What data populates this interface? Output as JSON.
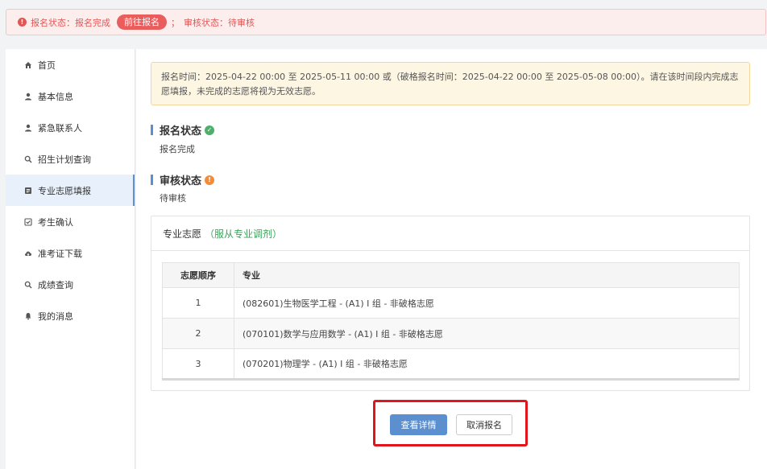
{
  "alert": {
    "status_text": "报名状态：报名完成",
    "go_button": "前往报名",
    "separator": "；",
    "review_text": "审核状态：待审核"
  },
  "sidebar": {
    "items": [
      {
        "label": "首页",
        "icon": "home-icon"
      },
      {
        "label": "基本信息",
        "icon": "user-icon"
      },
      {
        "label": "紧急联系人",
        "icon": "user-icon"
      },
      {
        "label": "招生计划查询",
        "icon": "search-icon"
      },
      {
        "label": "专业志愿填报",
        "icon": "form-icon",
        "active": true
      },
      {
        "label": "考生确认",
        "icon": "checkbox-icon"
      },
      {
        "label": "准考证下载",
        "icon": "cloud-download-icon"
      },
      {
        "label": "成绩查询",
        "icon": "search-icon"
      },
      {
        "label": "我的消息",
        "icon": "bell-icon"
      }
    ]
  },
  "notice": {
    "text": "报名时间：2025-04-22 00:00 至 2025-05-11 00:00 或（破格报名时间：2025-04-22 00:00 至 2025-05-08 00:00）。请在该时间段内完成志愿填报，未完成的志愿将视为无效志愿。"
  },
  "registration": {
    "title": "报名状态",
    "value": "报名完成"
  },
  "review": {
    "title": "审核状态",
    "value": "待审核"
  },
  "preferences": {
    "title": "专业志愿",
    "paren_open": "（",
    "adjust_label": "服从专业调剂",
    "paren_close": "）",
    "columns": [
      "志愿顺序",
      "专业"
    ],
    "rows": [
      {
        "order": "1",
        "major": "(082601)生物医学工程 - (A1) I 组 - 非破格志愿"
      },
      {
        "order": "2",
        "major": "(070101)数学与应用数学 - (A1) I 组 - 非破格志愿"
      },
      {
        "order": "3",
        "major": "(070201)物理学 - (A1) I 组 - 非破格志愿"
      }
    ]
  },
  "actions": {
    "view_details": "查看详情",
    "cancel_registration": "取消报名"
  },
  "colors": {
    "primary": "#5b8fd0",
    "alert": "#e25555",
    "success": "#4caf6a",
    "warning": "#f08c3a",
    "highlight_box": "#e0161c"
  }
}
